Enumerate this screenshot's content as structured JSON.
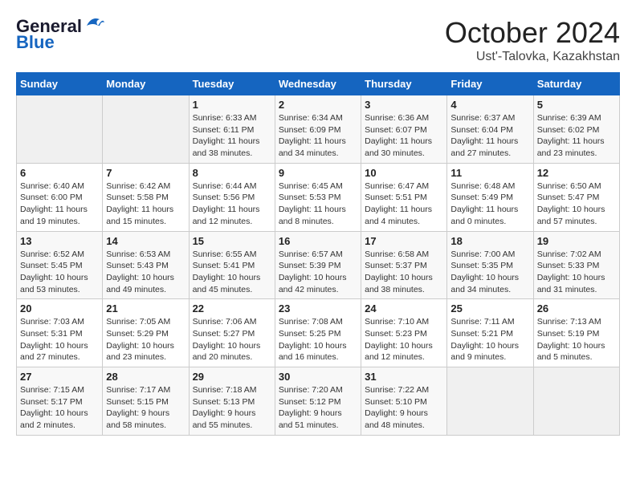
{
  "header": {
    "logo_line1": "General",
    "logo_line2": "Blue",
    "title": "October 2024",
    "subtitle": "Ust'-Talovka, Kazakhstan"
  },
  "weekdays": [
    "Sunday",
    "Monday",
    "Tuesday",
    "Wednesday",
    "Thursday",
    "Friday",
    "Saturday"
  ],
  "weeks": [
    [
      {
        "day": "",
        "info": ""
      },
      {
        "day": "",
        "info": ""
      },
      {
        "day": "1",
        "info": "Sunrise: 6:33 AM\nSunset: 6:11 PM\nDaylight: 11 hours\nand 38 minutes."
      },
      {
        "day": "2",
        "info": "Sunrise: 6:34 AM\nSunset: 6:09 PM\nDaylight: 11 hours\nand 34 minutes."
      },
      {
        "day": "3",
        "info": "Sunrise: 6:36 AM\nSunset: 6:07 PM\nDaylight: 11 hours\nand 30 minutes."
      },
      {
        "day": "4",
        "info": "Sunrise: 6:37 AM\nSunset: 6:04 PM\nDaylight: 11 hours\nand 27 minutes."
      },
      {
        "day": "5",
        "info": "Sunrise: 6:39 AM\nSunset: 6:02 PM\nDaylight: 11 hours\nand 23 minutes."
      }
    ],
    [
      {
        "day": "6",
        "info": "Sunrise: 6:40 AM\nSunset: 6:00 PM\nDaylight: 11 hours\nand 19 minutes."
      },
      {
        "day": "7",
        "info": "Sunrise: 6:42 AM\nSunset: 5:58 PM\nDaylight: 11 hours\nand 15 minutes."
      },
      {
        "day": "8",
        "info": "Sunrise: 6:44 AM\nSunset: 5:56 PM\nDaylight: 11 hours\nand 12 minutes."
      },
      {
        "day": "9",
        "info": "Sunrise: 6:45 AM\nSunset: 5:53 PM\nDaylight: 11 hours\nand 8 minutes."
      },
      {
        "day": "10",
        "info": "Sunrise: 6:47 AM\nSunset: 5:51 PM\nDaylight: 11 hours\nand 4 minutes."
      },
      {
        "day": "11",
        "info": "Sunrise: 6:48 AM\nSunset: 5:49 PM\nDaylight: 11 hours\nand 0 minutes."
      },
      {
        "day": "12",
        "info": "Sunrise: 6:50 AM\nSunset: 5:47 PM\nDaylight: 10 hours\nand 57 minutes."
      }
    ],
    [
      {
        "day": "13",
        "info": "Sunrise: 6:52 AM\nSunset: 5:45 PM\nDaylight: 10 hours\nand 53 minutes."
      },
      {
        "day": "14",
        "info": "Sunrise: 6:53 AM\nSunset: 5:43 PM\nDaylight: 10 hours\nand 49 minutes."
      },
      {
        "day": "15",
        "info": "Sunrise: 6:55 AM\nSunset: 5:41 PM\nDaylight: 10 hours\nand 45 minutes."
      },
      {
        "day": "16",
        "info": "Sunrise: 6:57 AM\nSunset: 5:39 PM\nDaylight: 10 hours\nand 42 minutes."
      },
      {
        "day": "17",
        "info": "Sunrise: 6:58 AM\nSunset: 5:37 PM\nDaylight: 10 hours\nand 38 minutes."
      },
      {
        "day": "18",
        "info": "Sunrise: 7:00 AM\nSunset: 5:35 PM\nDaylight: 10 hours\nand 34 minutes."
      },
      {
        "day": "19",
        "info": "Sunrise: 7:02 AM\nSunset: 5:33 PM\nDaylight: 10 hours\nand 31 minutes."
      }
    ],
    [
      {
        "day": "20",
        "info": "Sunrise: 7:03 AM\nSunset: 5:31 PM\nDaylight: 10 hours\nand 27 minutes."
      },
      {
        "day": "21",
        "info": "Sunrise: 7:05 AM\nSunset: 5:29 PM\nDaylight: 10 hours\nand 23 minutes."
      },
      {
        "day": "22",
        "info": "Sunrise: 7:06 AM\nSunset: 5:27 PM\nDaylight: 10 hours\nand 20 minutes."
      },
      {
        "day": "23",
        "info": "Sunrise: 7:08 AM\nSunset: 5:25 PM\nDaylight: 10 hours\nand 16 minutes."
      },
      {
        "day": "24",
        "info": "Sunrise: 7:10 AM\nSunset: 5:23 PM\nDaylight: 10 hours\nand 12 minutes."
      },
      {
        "day": "25",
        "info": "Sunrise: 7:11 AM\nSunset: 5:21 PM\nDaylight: 10 hours\nand 9 minutes."
      },
      {
        "day": "26",
        "info": "Sunrise: 7:13 AM\nSunset: 5:19 PM\nDaylight: 10 hours\nand 5 minutes."
      }
    ],
    [
      {
        "day": "27",
        "info": "Sunrise: 7:15 AM\nSunset: 5:17 PM\nDaylight: 10 hours\nand 2 minutes."
      },
      {
        "day": "28",
        "info": "Sunrise: 7:17 AM\nSunset: 5:15 PM\nDaylight: 9 hours\nand 58 minutes."
      },
      {
        "day": "29",
        "info": "Sunrise: 7:18 AM\nSunset: 5:13 PM\nDaylight: 9 hours\nand 55 minutes."
      },
      {
        "day": "30",
        "info": "Sunrise: 7:20 AM\nSunset: 5:12 PM\nDaylight: 9 hours\nand 51 minutes."
      },
      {
        "day": "31",
        "info": "Sunrise: 7:22 AM\nSunset: 5:10 PM\nDaylight: 9 hours\nand 48 minutes."
      },
      {
        "day": "",
        "info": ""
      },
      {
        "day": "",
        "info": ""
      }
    ]
  ]
}
